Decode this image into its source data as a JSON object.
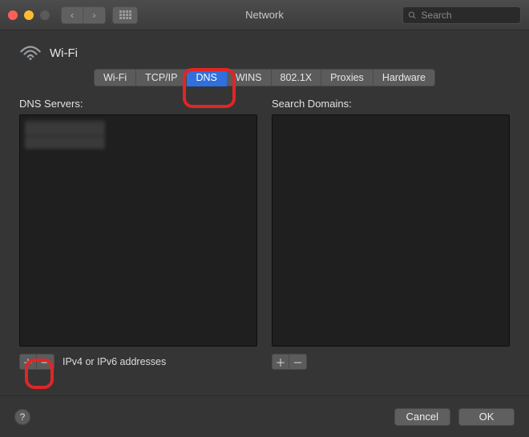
{
  "window": {
    "title": "Network",
    "search_placeholder": "Search"
  },
  "section": {
    "name": "Wi-Fi"
  },
  "tabs": [
    {
      "label": "Wi-Fi",
      "active": false
    },
    {
      "label": "TCP/IP",
      "active": false
    },
    {
      "label": "DNS",
      "active": true
    },
    {
      "label": "WINS",
      "active": false
    },
    {
      "label": "802.1X",
      "active": false
    },
    {
      "label": "Proxies",
      "active": false
    },
    {
      "label": "Hardware",
      "active": false
    }
  ],
  "dns_panel": {
    "label": "DNS Servers:",
    "caption": "IPv4 or IPv6 addresses",
    "items": []
  },
  "search_panel": {
    "label": "Search Domains:",
    "items": []
  },
  "buttons": {
    "cancel": "Cancel",
    "ok": "OK",
    "help": "?"
  },
  "glyphs": {
    "back": "‹",
    "fwd": "›",
    "plus": "＋",
    "minus": "－"
  }
}
